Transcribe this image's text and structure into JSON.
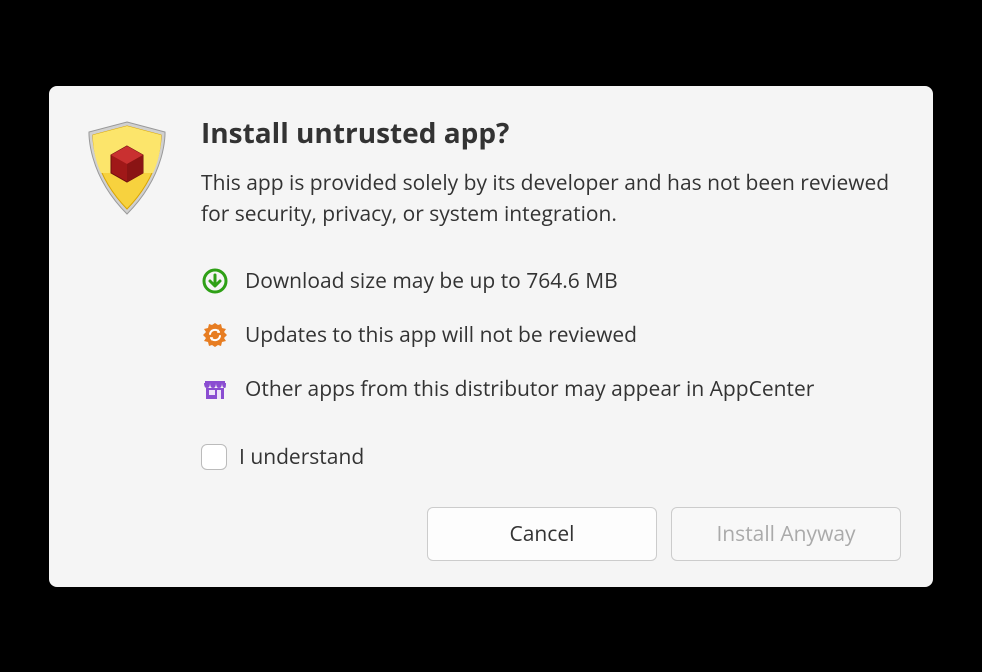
{
  "dialog": {
    "title": "Install untrusted app?",
    "subtitle": "This app is provided solely by its developer and has not been reviewed for security, privacy, or system integration.",
    "info": {
      "download": "Download size may be up to 764.6 MB",
      "updates": "Updates to this app will not be reviewed",
      "distributor": "Other apps from this distributor may appear in AppCenter"
    },
    "checkbox_label": "I understand",
    "buttons": {
      "cancel": "Cancel",
      "install": "Install Anyway"
    }
  },
  "icons": {
    "shield": "shield-warning-icon",
    "download": "download-circle-icon",
    "updates": "sync-badge-icon",
    "store": "store-icon"
  },
  "colors": {
    "download_icon": "#2ea016",
    "updates_icon": "#e77d22",
    "store_icon": "#8a4dd1"
  }
}
